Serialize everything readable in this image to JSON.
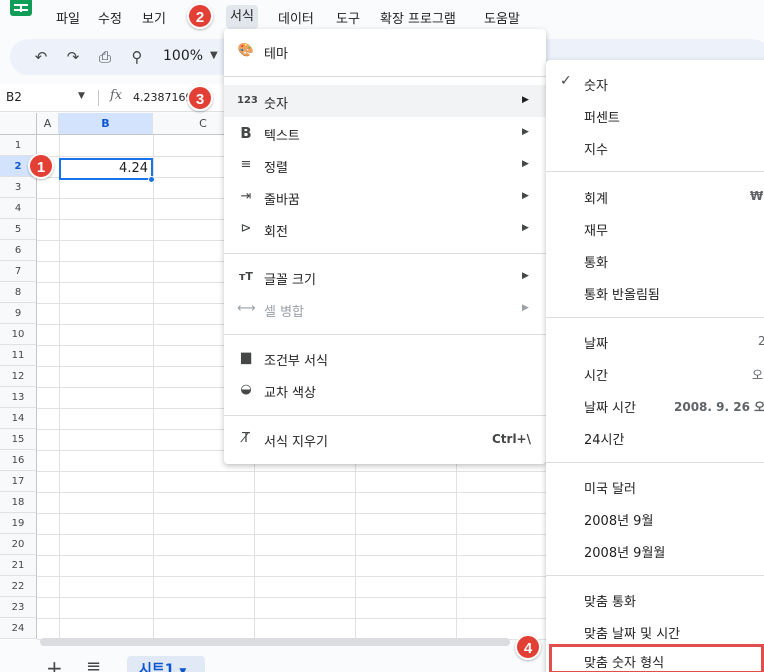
{
  "menubar": {
    "items": [
      "파일",
      "수정",
      "보기",
      "서식",
      "데이터",
      "도구",
      "확장 프로그램",
      "도움말"
    ]
  },
  "toolbar": {
    "zoom": "100%"
  },
  "formula_bar": {
    "cell_ref": "B2",
    "fx": "fx",
    "value": "4.2387169"
  },
  "grid": {
    "columns": [
      "A",
      "B",
      "C"
    ],
    "rows": [
      "1",
      "2",
      "3",
      "4",
      "5",
      "6",
      "7",
      "8",
      "9",
      "10",
      "11",
      "12",
      "13",
      "14",
      "15",
      "16",
      "17",
      "18",
      "19",
      "20",
      "21",
      "22",
      "23",
      "24"
    ],
    "active_cell_value": "4.24"
  },
  "sheet_tab": {
    "label": "시트1"
  },
  "format_menu": {
    "items": [
      {
        "label": "테마",
        "icon": "palette-icon"
      },
      {
        "label": "숫자",
        "icon": "123-icon"
      },
      {
        "label": "텍스트",
        "icon": "bold-icon"
      },
      {
        "label": "정렬",
        "icon": "align-icon"
      },
      {
        "label": "줄바꿈",
        "icon": "wrap-icon"
      },
      {
        "label": "회전",
        "icon": "rotate-icon"
      },
      {
        "label": "글꼴 크기",
        "icon": "font-size-icon"
      },
      {
        "label": "셀 병합",
        "icon": "merge-icon"
      },
      {
        "label": "조건부 서식",
        "icon": "paint-roller-icon"
      },
      {
        "label": "교차 색상",
        "icon": "drop-icon"
      },
      {
        "label": "서식 지우기",
        "icon": "clear-format-icon",
        "shortcut": "Ctrl+\\"
      }
    ]
  },
  "number_menu": {
    "items": [
      {
        "label": "숫자",
        "checked": true
      },
      {
        "label": "퍼센트"
      },
      {
        "label": "지수"
      },
      {
        "label": "회계",
        "sample": "₩"
      },
      {
        "label": "재무"
      },
      {
        "label": "통화"
      },
      {
        "label": "통화 반올림됨"
      },
      {
        "label": "날짜",
        "sample": "2"
      },
      {
        "label": "시간",
        "sample": "오"
      },
      {
        "label": "날짜 시간",
        "sample": "2008. 9. 26 오"
      },
      {
        "label": "24시간"
      },
      {
        "label": "미국 달러"
      },
      {
        "label": "2008년 9월"
      },
      {
        "label": "2008년 9월월"
      },
      {
        "label": "맞춤 통화"
      },
      {
        "label": "맞춤 날짜 및 시간"
      },
      {
        "label": "맞춤 숫자 형식"
      }
    ]
  },
  "badges": [
    "1",
    "2",
    "3",
    "4"
  ],
  "colors": {
    "badge": "#e23f35",
    "selection": "#1a73e8",
    "highlight_box": "#e04e4e"
  }
}
